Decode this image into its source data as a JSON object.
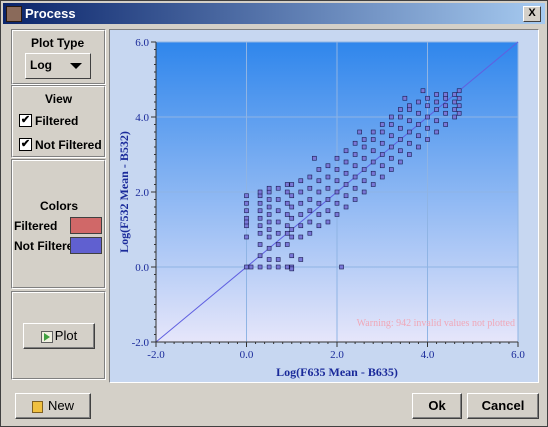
{
  "window": {
    "title": "Process",
    "close_glyph": "X"
  },
  "plot_type": {
    "heading": "Plot Type",
    "selected": "Log"
  },
  "view": {
    "heading": "View",
    "filtered_label": "Filtered",
    "filtered_checked": true,
    "not_filtered_label": "Not Filtered",
    "not_filtered_checked": true,
    "check_glyph": "✔"
  },
  "colors": {
    "heading": "Colors",
    "filtered_label": "Filtered",
    "filtered_color": "#d06868",
    "not_filtered_label": "Not Filtered",
    "not_filtered_color": "#6060d0"
  },
  "plot_button": {
    "label": "Plot"
  },
  "footer": {
    "new_label": "New",
    "ok_label": "Ok",
    "cancel_label": "Cancel"
  },
  "chart_data": {
    "type": "scatter",
    "xlabel": "Log(F635 Mean - B635)",
    "ylabel": "Log(F532 Mean - B532)",
    "xlim": [
      -2.0,
      6.0
    ],
    "ylim": [
      -2.0,
      6.0
    ],
    "x_ticks": [
      "-2.0",
      "0.0",
      "2.0",
      "4.0",
      "6.0"
    ],
    "y_ticks": [
      "-2.0",
      "0.0",
      "2.0",
      "4.0",
      "6.0"
    ],
    "grid": true,
    "reference_line": {
      "label": "",
      "from": [
        -2.0,
        -2.0
      ],
      "to": [
        6.0,
        6.0
      ]
    },
    "warning": "Warning: 942 invalid values not plotted",
    "series": [
      {
        "color": "#7a78d8",
        "points": [
          [
            0.0,
            0.0
          ],
          [
            0.0,
            1.1
          ],
          [
            0.0,
            1.3
          ],
          [
            0.0,
            1.5
          ],
          [
            0.0,
            1.7
          ],
          [
            0.0,
            1.9
          ],
          [
            0.0,
            1.2
          ],
          [
            0.0,
            0.8
          ],
          [
            0.3,
            0.0
          ],
          [
            0.3,
            0.3
          ],
          [
            0.3,
            0.6
          ],
          [
            0.3,
            0.9
          ],
          [
            0.3,
            1.1
          ],
          [
            0.3,
            1.3
          ],
          [
            0.3,
            1.5
          ],
          [
            0.3,
            1.7
          ],
          [
            0.3,
            1.9
          ],
          [
            0.3,
            2.0
          ],
          [
            0.5,
            0.0
          ],
          [
            0.5,
            0.2
          ],
          [
            0.5,
            0.5
          ],
          [
            0.5,
            0.8
          ],
          [
            0.5,
            1.0
          ],
          [
            0.5,
            1.2
          ],
          [
            0.5,
            1.4
          ],
          [
            0.5,
            1.6
          ],
          [
            0.5,
            1.8
          ],
          [
            0.5,
            2.0
          ],
          [
            0.5,
            2.1
          ],
          [
            0.7,
            0.0
          ],
          [
            0.7,
            0.2
          ],
          [
            0.7,
            0.6
          ],
          [
            0.7,
            0.9
          ],
          [
            0.7,
            1.2
          ],
          [
            0.7,
            1.5
          ],
          [
            0.7,
            1.8
          ],
          [
            0.7,
            2.1
          ],
          [
            0.9,
            0.6
          ],
          [
            0.9,
            0.9
          ],
          [
            0.9,
            1.1
          ],
          [
            0.9,
            1.4
          ],
          [
            0.9,
            1.7
          ],
          [
            0.9,
            2.0
          ],
          [
            0.9,
            2.2
          ],
          [
            1.0,
            0.0
          ],
          [
            1.0,
            0.3
          ],
          [
            1.0,
            0.8
          ],
          [
            1.0,
            1.0
          ],
          [
            1.0,
            1.3
          ],
          [
            1.0,
            1.6
          ],
          [
            1.0,
            1.9
          ],
          [
            1.0,
            2.2
          ],
          [
            1.2,
            0.2
          ],
          [
            1.2,
            0.8
          ],
          [
            1.2,
            1.1
          ],
          [
            1.2,
            1.4
          ],
          [
            1.2,
            1.7
          ],
          [
            1.2,
            2.0
          ],
          [
            1.2,
            2.3
          ],
          [
            1.4,
            0.9
          ],
          [
            1.4,
            1.2
          ],
          [
            1.4,
            1.5
          ],
          [
            1.4,
            1.8
          ],
          [
            1.4,
            2.1
          ],
          [
            1.4,
            2.4
          ],
          [
            1.6,
            1.1
          ],
          [
            1.6,
            1.4
          ],
          [
            1.6,
            1.7
          ],
          [
            1.6,
            2.0
          ],
          [
            1.6,
            2.3
          ],
          [
            1.6,
            2.6
          ],
          [
            1.8,
            1.2
          ],
          [
            1.8,
            1.5
          ],
          [
            1.8,
            1.8
          ],
          [
            1.8,
            2.1
          ],
          [
            1.8,
            2.4
          ],
          [
            1.8,
            2.7
          ],
          [
            2.0,
            1.4
          ],
          [
            2.0,
            1.7
          ],
          [
            2.0,
            2.0
          ],
          [
            2.0,
            2.3
          ],
          [
            2.0,
            2.6
          ],
          [
            2.0,
            2.9
          ],
          [
            2.2,
            1.6
          ],
          [
            2.2,
            1.9
          ],
          [
            2.2,
            2.2
          ],
          [
            2.2,
            2.5
          ],
          [
            2.2,
            2.8
          ],
          [
            2.2,
            3.1
          ],
          [
            2.4,
            1.8
          ],
          [
            2.4,
            2.1
          ],
          [
            2.4,
            2.4
          ],
          [
            2.4,
            2.7
          ],
          [
            2.4,
            3.0
          ],
          [
            2.4,
            3.3
          ],
          [
            2.6,
            2.0
          ],
          [
            2.6,
            2.3
          ],
          [
            2.6,
            2.6
          ],
          [
            2.6,
            2.9
          ],
          [
            2.6,
            3.2
          ],
          [
            2.6,
            3.4
          ],
          [
            2.8,
            2.2
          ],
          [
            2.8,
            2.5
          ],
          [
            2.8,
            2.8
          ],
          [
            2.8,
            3.1
          ],
          [
            2.8,
            3.4
          ],
          [
            2.8,
            3.6
          ],
          [
            3.0,
            2.4
          ],
          [
            3.0,
            2.7
          ],
          [
            3.0,
            3.0
          ],
          [
            3.0,
            3.3
          ],
          [
            3.0,
            3.6
          ],
          [
            3.0,
            3.8
          ],
          [
            3.2,
            2.6
          ],
          [
            3.2,
            2.9
          ],
          [
            3.2,
            3.2
          ],
          [
            3.2,
            3.5
          ],
          [
            3.2,
            3.8
          ],
          [
            3.2,
            4.0
          ],
          [
            3.4,
            2.8
          ],
          [
            3.4,
            3.1
          ],
          [
            3.4,
            3.4
          ],
          [
            3.4,
            3.7
          ],
          [
            3.4,
            4.0
          ],
          [
            3.4,
            4.2
          ],
          [
            3.6,
            3.0
          ],
          [
            3.6,
            3.3
          ],
          [
            3.6,
            3.6
          ],
          [
            3.6,
            3.9
          ],
          [
            3.6,
            4.2
          ],
          [
            3.6,
            4.3
          ],
          [
            3.8,
            3.2
          ],
          [
            3.8,
            3.5
          ],
          [
            3.8,
            3.8
          ],
          [
            3.8,
            4.1
          ],
          [
            3.8,
            4.4
          ],
          [
            4.0,
            3.4
          ],
          [
            4.0,
            3.7
          ],
          [
            4.0,
            4.0
          ],
          [
            4.0,
            4.3
          ],
          [
            4.0,
            4.5
          ],
          [
            4.2,
            3.6
          ],
          [
            4.2,
            3.9
          ],
          [
            4.2,
            4.2
          ],
          [
            4.2,
            4.4
          ],
          [
            4.2,
            4.6
          ],
          [
            4.4,
            3.8
          ],
          [
            4.4,
            4.1
          ],
          [
            4.4,
            4.3
          ],
          [
            4.4,
            4.5
          ],
          [
            4.4,
            4.6
          ],
          [
            4.6,
            4.0
          ],
          [
            4.6,
            4.2
          ],
          [
            4.6,
            4.4
          ],
          [
            4.6,
            4.6
          ],
          [
            4.7,
            4.1
          ],
          [
            4.7,
            4.3
          ],
          [
            4.7,
            4.5
          ],
          [
            4.7,
            4.7
          ],
          [
            1.0,
            -0.05
          ],
          [
            2.1,
            0.0
          ],
          [
            0.9,
            0.0
          ],
          [
            0.1,
            0.0
          ],
          [
            1.5,
            2.9
          ],
          [
            2.5,
            3.6
          ],
          [
            3.5,
            4.5
          ],
          [
            3.9,
            4.7
          ]
        ]
      }
    ]
  }
}
